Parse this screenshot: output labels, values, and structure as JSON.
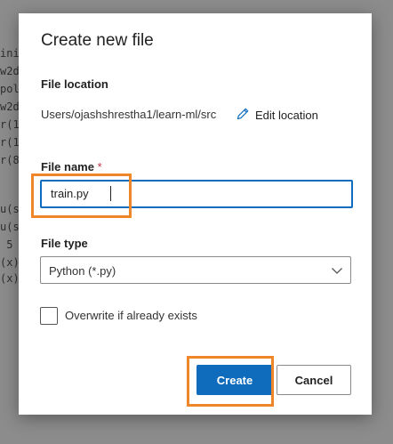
{
  "background_code": {
    "lines": [
      "ini",
      "w2d",
      "pol",
      "w2d",
      "r(1",
      "r(1",
      "r(8",
      "u(s",
      "u(s",
      " 5",
      "(x)",
      "(x)"
    ]
  },
  "dialog": {
    "title": "Create new file",
    "file_location": {
      "label": "File location",
      "path": "Users/ojashshrestha1/learn-ml/src",
      "edit_label": "Edit location"
    },
    "file_name": {
      "label": "File name",
      "required_marker": "*",
      "value": "train.py"
    },
    "file_type": {
      "label": "File type",
      "selected": "Python (*.py)"
    },
    "overwrite": {
      "label": "Overwrite if already exists",
      "checked": false
    },
    "buttons": {
      "create_label": "Create",
      "cancel_label": "Cancel"
    }
  },
  "colors": {
    "primary": "#0f6cbd",
    "highlight": "#f0862a",
    "required": "#c4314b"
  },
  "icons": [
    "pencil-icon",
    "chevron-down-icon"
  ]
}
